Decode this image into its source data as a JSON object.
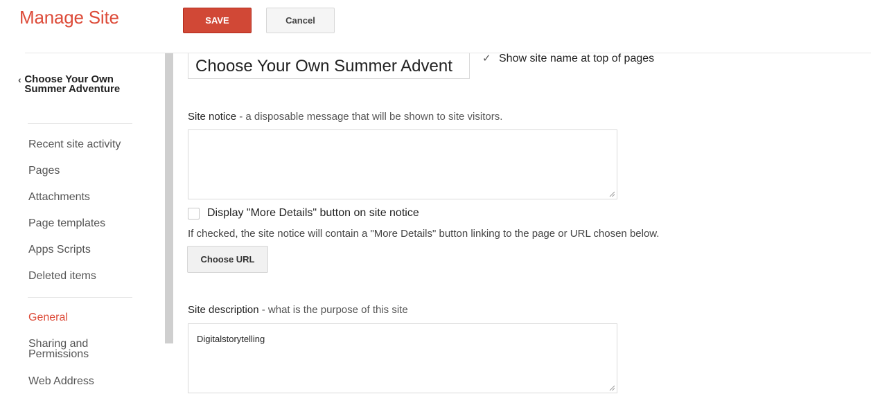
{
  "header": {
    "title": "Manage Site",
    "save_label": "SAVE",
    "cancel_label": "Cancel"
  },
  "sidebar": {
    "site_name": "Choose Your Own Summer Adventure",
    "site_items": [
      {
        "label": "Recent site activity"
      },
      {
        "label": "Pages"
      },
      {
        "label": "Attachments"
      },
      {
        "label": "Page templates"
      },
      {
        "label": "Apps Scripts"
      },
      {
        "label": "Deleted items"
      }
    ],
    "settings_items": [
      {
        "label": "General",
        "active": true
      },
      {
        "label": "Sharing and Permissions",
        "active": false
      },
      {
        "label": "Web Address",
        "active": false
      }
    ]
  },
  "main": {
    "site_name_value": "Choose Your Own Summer Advent",
    "show_site_name_label": "Show site name at top of pages",
    "show_site_name_checked": true,
    "site_notice": {
      "label": "Site notice",
      "hint": " - a disposable message that will be shown to site visitors.",
      "value": ""
    },
    "more_details_label": "Display \"More Details\" button on site notice",
    "more_details_checked": false,
    "more_details_help": "If checked, the site notice will contain a \"More Details\" button linking to the page or URL chosen below.",
    "choose_url_label": "Choose URL",
    "site_description": {
      "label": "Site description",
      "hint": " - what is the purpose of this site",
      "value": "Digitalstorytelling"
    }
  },
  "colors": {
    "accent": "#dd4b39",
    "save_button": "#d14836"
  }
}
